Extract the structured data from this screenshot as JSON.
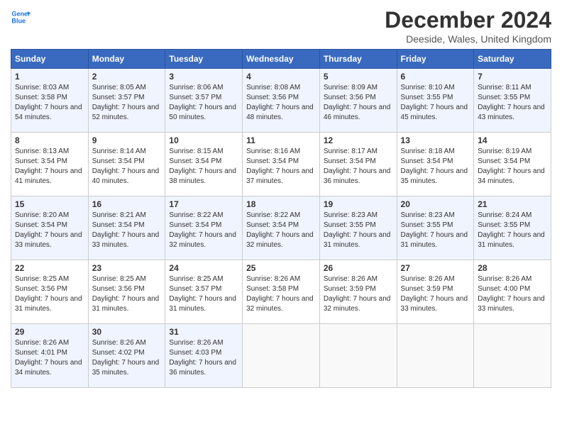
{
  "header": {
    "logo_line1": "General",
    "logo_line2": "Blue",
    "month_title": "December 2024",
    "location": "Deeside, Wales, United Kingdom"
  },
  "days_of_week": [
    "Sunday",
    "Monday",
    "Tuesday",
    "Wednesday",
    "Thursday",
    "Friday",
    "Saturday"
  ],
  "weeks": [
    [
      {
        "day": "1",
        "sunrise": "Sunrise: 8:03 AM",
        "sunset": "Sunset: 3:58 PM",
        "daylight": "Daylight: 7 hours and 54 minutes."
      },
      {
        "day": "2",
        "sunrise": "Sunrise: 8:05 AM",
        "sunset": "Sunset: 3:57 PM",
        "daylight": "Daylight: 7 hours and 52 minutes."
      },
      {
        "day": "3",
        "sunrise": "Sunrise: 8:06 AM",
        "sunset": "Sunset: 3:57 PM",
        "daylight": "Daylight: 7 hours and 50 minutes."
      },
      {
        "day": "4",
        "sunrise": "Sunrise: 8:08 AM",
        "sunset": "Sunset: 3:56 PM",
        "daylight": "Daylight: 7 hours and 48 minutes."
      },
      {
        "day": "5",
        "sunrise": "Sunrise: 8:09 AM",
        "sunset": "Sunset: 3:56 PM",
        "daylight": "Daylight: 7 hours and 46 minutes."
      },
      {
        "day": "6",
        "sunrise": "Sunrise: 8:10 AM",
        "sunset": "Sunset: 3:55 PM",
        "daylight": "Daylight: 7 hours and 45 minutes."
      },
      {
        "day": "7",
        "sunrise": "Sunrise: 8:11 AM",
        "sunset": "Sunset: 3:55 PM",
        "daylight": "Daylight: 7 hours and 43 minutes."
      }
    ],
    [
      {
        "day": "8",
        "sunrise": "Sunrise: 8:13 AM",
        "sunset": "Sunset: 3:54 PM",
        "daylight": "Daylight: 7 hours and 41 minutes."
      },
      {
        "day": "9",
        "sunrise": "Sunrise: 8:14 AM",
        "sunset": "Sunset: 3:54 PM",
        "daylight": "Daylight: 7 hours and 40 minutes."
      },
      {
        "day": "10",
        "sunrise": "Sunrise: 8:15 AM",
        "sunset": "Sunset: 3:54 PM",
        "daylight": "Daylight: 7 hours and 38 minutes."
      },
      {
        "day": "11",
        "sunrise": "Sunrise: 8:16 AM",
        "sunset": "Sunset: 3:54 PM",
        "daylight": "Daylight: 7 hours and 37 minutes."
      },
      {
        "day": "12",
        "sunrise": "Sunrise: 8:17 AM",
        "sunset": "Sunset: 3:54 PM",
        "daylight": "Daylight: 7 hours and 36 minutes."
      },
      {
        "day": "13",
        "sunrise": "Sunrise: 8:18 AM",
        "sunset": "Sunset: 3:54 PM",
        "daylight": "Daylight: 7 hours and 35 minutes."
      },
      {
        "day": "14",
        "sunrise": "Sunrise: 8:19 AM",
        "sunset": "Sunset: 3:54 PM",
        "daylight": "Daylight: 7 hours and 34 minutes."
      }
    ],
    [
      {
        "day": "15",
        "sunrise": "Sunrise: 8:20 AM",
        "sunset": "Sunset: 3:54 PM",
        "daylight": "Daylight: 7 hours and 33 minutes."
      },
      {
        "day": "16",
        "sunrise": "Sunrise: 8:21 AM",
        "sunset": "Sunset: 3:54 PM",
        "daylight": "Daylight: 7 hours and 33 minutes."
      },
      {
        "day": "17",
        "sunrise": "Sunrise: 8:22 AM",
        "sunset": "Sunset: 3:54 PM",
        "daylight": "Daylight: 7 hours and 32 minutes."
      },
      {
        "day": "18",
        "sunrise": "Sunrise: 8:22 AM",
        "sunset": "Sunset: 3:54 PM",
        "daylight": "Daylight: 7 hours and 32 minutes."
      },
      {
        "day": "19",
        "sunrise": "Sunrise: 8:23 AM",
        "sunset": "Sunset: 3:55 PM",
        "daylight": "Daylight: 7 hours and 31 minutes."
      },
      {
        "day": "20",
        "sunrise": "Sunrise: 8:23 AM",
        "sunset": "Sunset: 3:55 PM",
        "daylight": "Daylight: 7 hours and 31 minutes."
      },
      {
        "day": "21",
        "sunrise": "Sunrise: 8:24 AM",
        "sunset": "Sunset: 3:55 PM",
        "daylight": "Daylight: 7 hours and 31 minutes."
      }
    ],
    [
      {
        "day": "22",
        "sunrise": "Sunrise: 8:25 AM",
        "sunset": "Sunset: 3:56 PM",
        "daylight": "Daylight: 7 hours and 31 minutes."
      },
      {
        "day": "23",
        "sunrise": "Sunrise: 8:25 AM",
        "sunset": "Sunset: 3:56 PM",
        "daylight": "Daylight: 7 hours and 31 minutes."
      },
      {
        "day": "24",
        "sunrise": "Sunrise: 8:25 AM",
        "sunset": "Sunset: 3:57 PM",
        "daylight": "Daylight: 7 hours and 31 minutes."
      },
      {
        "day": "25",
        "sunrise": "Sunrise: 8:26 AM",
        "sunset": "Sunset: 3:58 PM",
        "daylight": "Daylight: 7 hours and 32 minutes."
      },
      {
        "day": "26",
        "sunrise": "Sunrise: 8:26 AM",
        "sunset": "Sunset: 3:59 PM",
        "daylight": "Daylight: 7 hours and 32 minutes."
      },
      {
        "day": "27",
        "sunrise": "Sunrise: 8:26 AM",
        "sunset": "Sunset: 3:59 PM",
        "daylight": "Daylight: 7 hours and 33 minutes."
      },
      {
        "day": "28",
        "sunrise": "Sunrise: 8:26 AM",
        "sunset": "Sunset: 4:00 PM",
        "daylight": "Daylight: 7 hours and 33 minutes."
      }
    ],
    [
      {
        "day": "29",
        "sunrise": "Sunrise: 8:26 AM",
        "sunset": "Sunset: 4:01 PM",
        "daylight": "Daylight: 7 hours and 34 minutes."
      },
      {
        "day": "30",
        "sunrise": "Sunrise: 8:26 AM",
        "sunset": "Sunset: 4:02 PM",
        "daylight": "Daylight: 7 hours and 35 minutes."
      },
      {
        "day": "31",
        "sunrise": "Sunrise: 8:26 AM",
        "sunset": "Sunset: 4:03 PM",
        "daylight": "Daylight: 7 hours and 36 minutes."
      },
      null,
      null,
      null,
      null
    ]
  ]
}
